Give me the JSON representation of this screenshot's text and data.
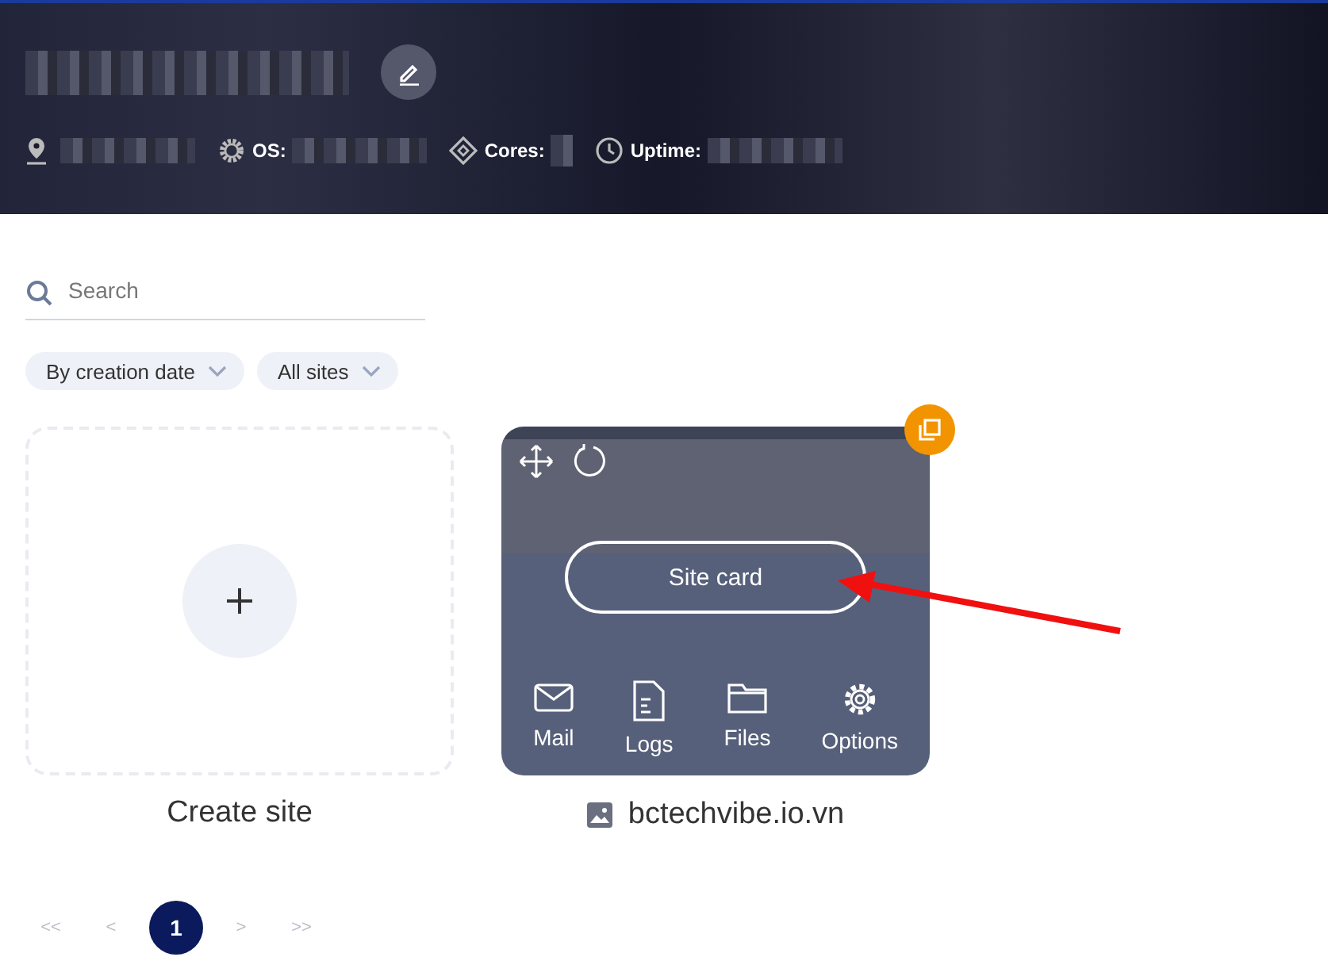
{
  "header": {
    "stats": [
      {
        "kind": "location"
      },
      {
        "kind": "os",
        "label": "OS:"
      },
      {
        "kind": "cores",
        "label": "Cores:"
      },
      {
        "kind": "uptime",
        "label": "Uptime:"
      }
    ]
  },
  "search": {
    "placeholder": "Search"
  },
  "filters": [
    {
      "label": "By creation date"
    },
    {
      "label": "All sites"
    }
  ],
  "create_card": {
    "label": "Create site"
  },
  "site_card": {
    "button": "Site card",
    "actions": [
      {
        "kind": "mail",
        "label": "Mail"
      },
      {
        "kind": "logs",
        "label": "Logs"
      },
      {
        "kind": "files",
        "label": "Files"
      },
      {
        "kind": "options",
        "label": "Options"
      }
    ],
    "name": "bctechvibe.io.vn"
  },
  "pagination": {
    "first": "<<",
    "prev": "<",
    "pages": [
      {
        "label": "1",
        "selected": true
      }
    ],
    "next": ">",
    "last": ">>"
  }
}
